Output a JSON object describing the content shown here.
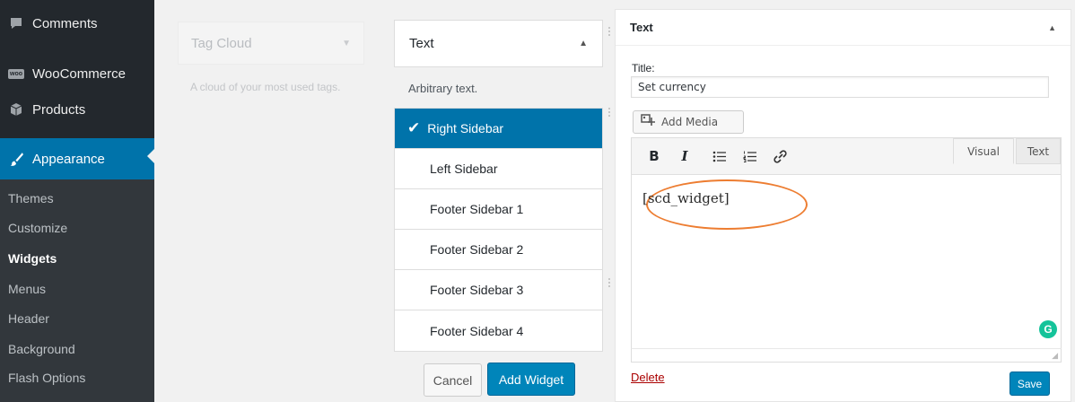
{
  "admin_menu": {
    "comments": "Comments",
    "woocommerce": "WooCommerce",
    "woo_badge": "woo",
    "products": "Products",
    "appearance": "Appearance",
    "submenu": [
      "Themes",
      "Customize",
      "Widgets",
      "Menus",
      "Header",
      "Background",
      "Flash Options"
    ],
    "current_submenu": "Widgets"
  },
  "available_widget": {
    "name": "Tag Cloud",
    "description": "A cloud of your most used tags."
  },
  "chooser": {
    "widget_name": "Text",
    "description": "Arbitrary text.",
    "sidebars": [
      "Right Sidebar",
      "Left Sidebar",
      "Footer Sidebar 1",
      "Footer Sidebar 2",
      "Footer Sidebar 3",
      "Footer Sidebar 4"
    ],
    "selected": "Right Sidebar",
    "cancel_label": "Cancel",
    "add_label": "Add Widget"
  },
  "text_widget": {
    "header": "Text",
    "title_label": "Title:",
    "title_value": "Set currency",
    "add_media_label": "Add Media",
    "tabs": [
      "Visual",
      "Text"
    ],
    "active_tab": "Visual",
    "content": "[scd_widget]",
    "delete_label": "Delete",
    "save_label": "Save",
    "highlight_color": "#ed7d31"
  },
  "toolbar": {
    "bold": "B",
    "italic": "I",
    "icons": [
      "bold-icon",
      "italic-icon",
      "bullet-list-icon",
      "numbered-list-icon",
      "link-icon"
    ]
  },
  "colors": {
    "admin_bg": "#23282d",
    "admin_accent": "#0073aa",
    "primary_button": "#0085ba",
    "delete": "#a00000",
    "grammarly": "#15c39a"
  }
}
